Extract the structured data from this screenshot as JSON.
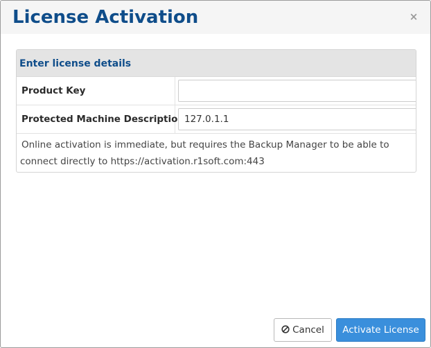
{
  "dialog": {
    "title": "License Activation",
    "close_label": "×"
  },
  "panel": {
    "heading": "Enter license details",
    "fields": {
      "product_key": {
        "label": "Product Key",
        "value": ""
      },
      "machine_description": {
        "label": "Protected Machine Description",
        "value": "127.0.1.1"
      }
    },
    "note": {
      "line1": "Online activation is immediate, but requires the Backup Manager to be able to",
      "line2": "connect directly to https://activation.r1soft.com:443"
    }
  },
  "footer": {
    "cancel_label": "Cancel",
    "cancel_icon": "ban-icon",
    "activate_label": "Activate License"
  },
  "colors": {
    "title": "#0f4d8a",
    "header_bg": "#f5f5f5",
    "panel_heading_bg": "#e4e4e4",
    "primary_button": "#3a8fdc"
  }
}
